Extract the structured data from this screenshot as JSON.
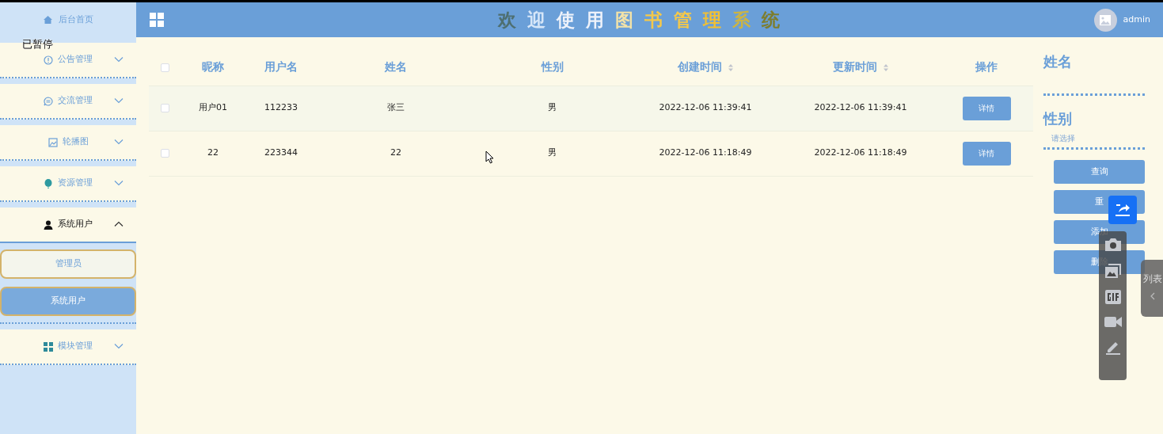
{
  "sidebar": {
    "home": "后台首页",
    "menus": [
      {
        "label": "公告管理",
        "expanded": false
      },
      {
        "label": "交流管理",
        "expanded": false
      },
      {
        "label": "轮播图",
        "expanded": false
      },
      {
        "label": "资源管理",
        "expanded": false
      },
      {
        "label": "系统用户",
        "expanded": true,
        "children": [
          {
            "label": "管理员",
            "selected": false
          },
          {
            "label": "系统用户",
            "selected": true
          }
        ]
      },
      {
        "label": "模块管理",
        "expanded": false
      }
    ]
  },
  "header": {
    "title_chars": [
      {
        "text": "欢",
        "color": "#4e6f70"
      },
      {
        "text": "迎",
        "color": "#d6e6f8"
      },
      {
        "text": "使",
        "color": "#eef2fa"
      },
      {
        "text": "用",
        "color": "#eef2fa"
      },
      {
        "text": "图",
        "color": "#f2e2a8"
      },
      {
        "text": "书",
        "color": "#f4c84a"
      },
      {
        "text": "管",
        "color": "#f4c84a"
      },
      {
        "text": "理",
        "color": "#f2c034"
      },
      {
        "text": "系",
        "color": "#cbb444"
      },
      {
        "text": "统",
        "color": "#7d7d2e"
      }
    ],
    "user": "admin"
  },
  "table": {
    "select_all_checked": false,
    "columns": [
      {
        "label": "昵称",
        "sortable": false
      },
      {
        "label": "用户名",
        "sortable": false
      },
      {
        "label": "姓名",
        "sortable": false
      },
      {
        "label": "性别",
        "sortable": false
      },
      {
        "label": "创建时间",
        "sortable": true
      },
      {
        "label": "更新时间",
        "sortable": true
      },
      {
        "label": "操作",
        "sortable": false
      }
    ],
    "rows": [
      {
        "checked": false,
        "cells": [
          "用户01",
          "112233",
          "张三",
          "男",
          "2022-12-06 11:39:41",
          "2022-12-06 11:39:41"
        ],
        "action": "详情"
      },
      {
        "checked": false,
        "cells": [
          "22",
          "223344",
          "22",
          "男",
          "2022-12-06 11:18:49",
          "2022-12-06 11:18:49"
        ],
        "action": "详情"
      }
    ]
  },
  "search_panel": {
    "fields": [
      {
        "label": "姓名",
        "kind": "text"
      },
      {
        "label": "性别",
        "kind": "select",
        "placeholder": "请选择"
      }
    ],
    "buttons": [
      "查询",
      "重",
      "添加",
      "删除"
    ]
  },
  "overlay": {
    "status": "已暂停",
    "side_tab": "列表"
  }
}
